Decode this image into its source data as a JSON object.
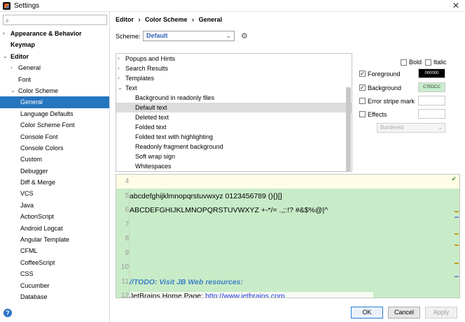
{
  "window": {
    "title": "Settings",
    "close_glyph": "✕"
  },
  "search": {
    "placeholder": ""
  },
  "tree": {
    "items": [
      {
        "label": "Appearance & Behavior",
        "indent": 0,
        "bold": true,
        "arrow": "›"
      },
      {
        "label": "Keymap",
        "indent": 0,
        "bold": true,
        "arrow": ""
      },
      {
        "label": "Editor",
        "indent": 0,
        "bold": true,
        "arrow": "⌄"
      },
      {
        "label": "General",
        "indent": 1,
        "bold": false,
        "arrow": "›"
      },
      {
        "label": "Font",
        "indent": 1,
        "bold": false,
        "arrow": ""
      },
      {
        "label": "Color Scheme",
        "indent": 1,
        "bold": false,
        "arrow": "⌄"
      },
      {
        "label": "General",
        "indent": 2,
        "bold": false,
        "arrow": "",
        "selected": true
      },
      {
        "label": "Language Defaults",
        "indent": 2,
        "bold": false,
        "arrow": ""
      },
      {
        "label": "Color Scheme Font",
        "indent": 2,
        "bold": false,
        "arrow": ""
      },
      {
        "label": "Console Font",
        "indent": 2,
        "bold": false,
        "arrow": ""
      },
      {
        "label": "Console Colors",
        "indent": 2,
        "bold": false,
        "arrow": ""
      },
      {
        "label": "Custom",
        "indent": 2,
        "bold": false,
        "arrow": ""
      },
      {
        "label": "Debugger",
        "indent": 2,
        "bold": false,
        "arrow": ""
      },
      {
        "label": "Diff & Merge",
        "indent": 2,
        "bold": false,
        "arrow": ""
      },
      {
        "label": "VCS",
        "indent": 2,
        "bold": false,
        "arrow": ""
      },
      {
        "label": "Java",
        "indent": 2,
        "bold": false,
        "arrow": ""
      },
      {
        "label": "ActionScript",
        "indent": 2,
        "bold": false,
        "arrow": ""
      },
      {
        "label": "Android Logcat",
        "indent": 2,
        "bold": false,
        "arrow": ""
      },
      {
        "label": "Angular Template",
        "indent": 2,
        "bold": false,
        "arrow": ""
      },
      {
        "label": "CFML",
        "indent": 2,
        "bold": false,
        "arrow": ""
      },
      {
        "label": "CoffeeScript",
        "indent": 2,
        "bold": false,
        "arrow": ""
      },
      {
        "label": "CSS",
        "indent": 2,
        "bold": false,
        "arrow": ""
      },
      {
        "label": "Cucumber",
        "indent": 2,
        "bold": false,
        "arrow": ""
      },
      {
        "label": "Database",
        "indent": 2,
        "bold": false,
        "arrow": ""
      }
    ]
  },
  "breadcrumb": {
    "a": "Editor",
    "sep1": "›",
    "b": "Color Scheme",
    "sep2": "›",
    "c": "General"
  },
  "scheme": {
    "label": "Scheme:",
    "value": "Default",
    "arrow": "⌄",
    "gear": "⚙"
  },
  "list": {
    "items": [
      {
        "label": "Popups and Hints",
        "indent": 0,
        "arrow": "›"
      },
      {
        "label": "Search Results",
        "indent": 0,
        "arrow": "›"
      },
      {
        "label": "Templates",
        "indent": 0,
        "arrow": "›"
      },
      {
        "label": "Text",
        "indent": 0,
        "arrow": "⌄"
      },
      {
        "label": "Background in readonly files",
        "indent": 1,
        "arrow": ""
      },
      {
        "label": "Default text",
        "indent": 1,
        "arrow": "",
        "selected": true
      },
      {
        "label": "Deleted text",
        "indent": 1,
        "arrow": ""
      },
      {
        "label": "Folded text",
        "indent": 1,
        "arrow": ""
      },
      {
        "label": "Folded text with highlighting",
        "indent": 1,
        "arrow": ""
      },
      {
        "label": "Readonly fragment background",
        "indent": 1,
        "arrow": ""
      },
      {
        "label": "Soft wrap sign",
        "indent": 1,
        "arrow": ""
      },
      {
        "label": "Whitespaces",
        "indent": 1,
        "arrow": ""
      }
    ]
  },
  "attributes": {
    "bold": {
      "label": "Bold",
      "checked": false
    },
    "italic": {
      "label": "Italic",
      "checked": false
    },
    "foreground": {
      "label": "Foreground",
      "checked": true,
      "value": "000000",
      "color": "#000000",
      "text_color": "#ffffff"
    },
    "background": {
      "label": "Background",
      "checked": true,
      "value": "C7EDCC",
      "color": "#C7EDCC",
      "text_color": "#333333"
    },
    "error_stripe": {
      "label": "Error stripe mark",
      "checked": false
    },
    "effects": {
      "label": "Effects",
      "checked": false,
      "style": "Bordered",
      "arrow": "⌄"
    }
  },
  "preview": {
    "lines": [
      {
        "num": "4",
        "text": ""
      },
      {
        "num": "5",
        "text": "abcdefghijklmnopqrstuvwxyz 0123456789 (){}[]"
      },
      {
        "num": "6",
        "text": "ABCDEFGHIJKLMNOPQRSTUVWXYZ +-*/= .,;:!? #&$%@|^"
      },
      {
        "num": "7",
        "text": ""
      },
      {
        "num": "8",
        "text": ""
      },
      {
        "num": "9",
        "text": ""
      },
      {
        "num": "10",
        "text": ""
      },
      {
        "num": "11",
        "text": "//TODO: Visit JB Web resources:"
      },
      {
        "num": "12",
        "text_a": "JetBrains Home Page: ",
        "link": "http://www.jetbrains.com"
      }
    ],
    "check_glyph": "✔"
  },
  "buttons": {
    "help": "?",
    "ok": "OK",
    "cancel": "Cancel",
    "apply": "Apply"
  }
}
